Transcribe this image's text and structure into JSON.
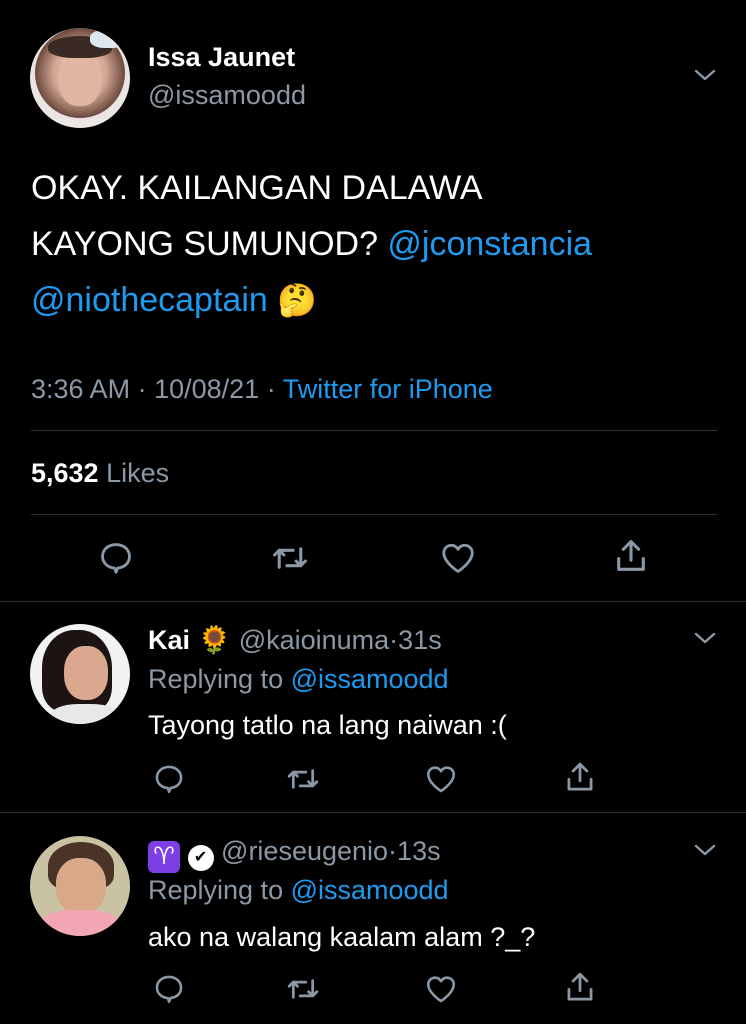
{
  "main_tweet": {
    "author_name": "Issa Jaunet",
    "author_handle": "@issamoodd",
    "text_line1": "OKAY. KAILANGAN DALAWA",
    "text_line2_plain": "KAYONG SUMUNOD? ",
    "mention1": "@jconstancia",
    "mention2": "@niothecaptain",
    "emoji": "🤔",
    "time": "3:36 AM",
    "date": "10/08/21",
    "separator": "·",
    "source": "Twitter for iPhone",
    "likes_count": "5,632",
    "likes_label": "Likes"
  },
  "replies": [
    {
      "name": "Kai",
      "name_emoji": "🌻",
      "handle": "@kaioinuma",
      "separator": "·",
      "age": "31s",
      "replying_prefix": "Replying to ",
      "replying_handle": "@issamoodd",
      "text": "Tayong tatlo na lang naiwan :("
    },
    {
      "name_emoji": "♈",
      "verified_glyph": "✔",
      "handle": "@rieseugenio",
      "separator": "·",
      "age": "13s",
      "replying_prefix": "Replying to ",
      "replying_handle": "@issamoodd",
      "text": "ako na walang kaalam alam ?_?"
    }
  ],
  "colors": {
    "background": "#000000",
    "link": "#1d9bf0",
    "secondary_text": "#8b98a5",
    "divider": "#2f3336",
    "icon": "#8b98a5",
    "aries_badge": "#7b3fe4"
  },
  "icons": {
    "reply": "speech-bubble-icon",
    "retweet": "retweet-arrows-icon",
    "like": "heart-icon",
    "share": "share-upload-icon",
    "more": "chevron-down-icon"
  }
}
